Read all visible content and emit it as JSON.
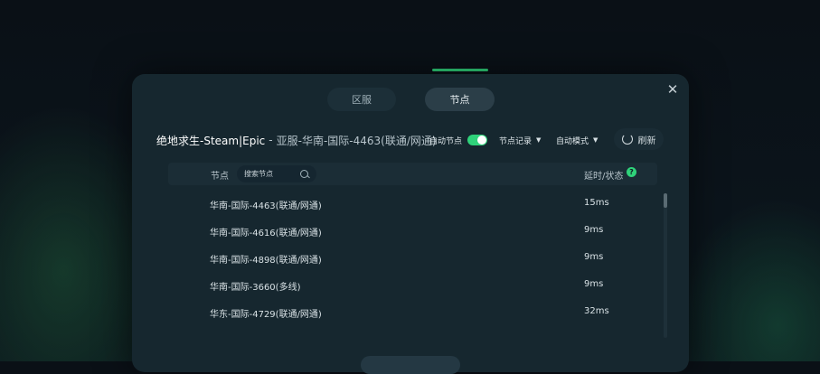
{
  "tabs": [
    {
      "label": "区服"
    },
    {
      "label": "节点"
    }
  ],
  "header": {
    "game": "绝地求生-Steam|Epic",
    "separator": "-",
    "server": "亚服-华南-国际-4463(联通/网通)",
    "auto_node_label": "自动节点",
    "auto_node_enabled": true,
    "node_record_label": "节点记录",
    "auto_mode_label": "自动模式",
    "refresh_label": "刷新"
  },
  "table": {
    "col_node": "节点",
    "search_placeholder": "搜索节点",
    "col_latency": "延时/状态",
    "rows": [
      {
        "name": "华南-国际-4463(联通/网通)",
        "latency": "15ms"
      },
      {
        "name": "华南-国际-4616(联通/网通)",
        "latency": "9ms"
      },
      {
        "name": "华南-国际-4898(联通/网通)",
        "latency": "9ms"
      },
      {
        "name": "华南-国际-3660(多线)",
        "latency": "9ms"
      },
      {
        "name": "华东-国际-4729(联通/网通)",
        "latency": "32ms"
      }
    ]
  },
  "colors": {
    "accent": "#2fd27a",
    "panel": "#16272f"
  }
}
